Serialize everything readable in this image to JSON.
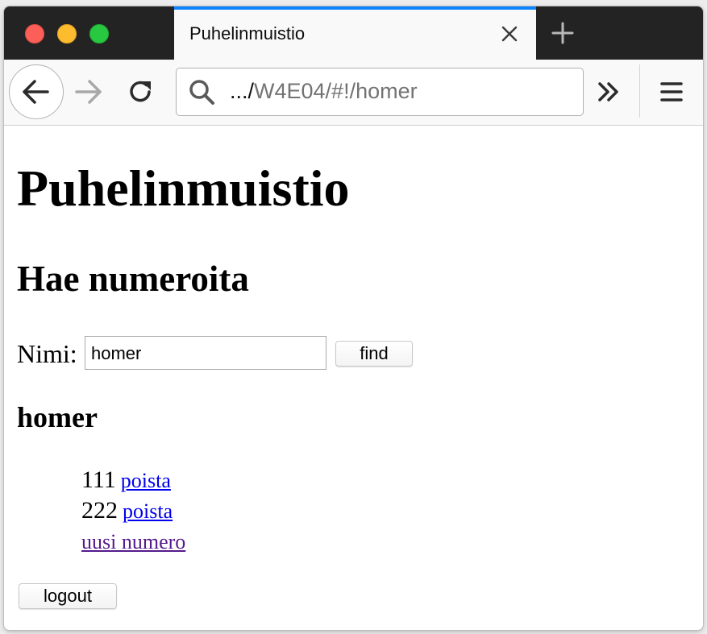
{
  "browser": {
    "tab_title": "Puhelinmuistio",
    "url_prefix": ".../",
    "url_main": "W4E04/#!/homer"
  },
  "page": {
    "title": "Puhelinmuistio",
    "search_heading": "Hae numeroita",
    "name_label": "Nimi:",
    "search_value": "homer",
    "find_label": "find",
    "result_name": "homer",
    "numbers": [
      {
        "number": "111",
        "delete_label": "poista"
      },
      {
        "number": "222",
        "delete_label": "poista"
      }
    ],
    "new_number_label": "uusi numero",
    "logout_label": "logout"
  },
  "icons": {
    "close_tab": "close-icon",
    "new_tab": "plus-icon",
    "back": "arrow-left-icon",
    "forward": "arrow-right-icon",
    "reload": "reload-icon",
    "search": "search-icon",
    "overflow": "double-chevron-icon",
    "menu": "hamburger-icon"
  },
  "colors": {
    "tab_accent": "#0a84ff",
    "link": "#0000ee",
    "visited_link": "#551a8b",
    "traffic_close": "#fc5f57",
    "traffic_min": "#fdbc2e",
    "traffic_max": "#28c840"
  }
}
